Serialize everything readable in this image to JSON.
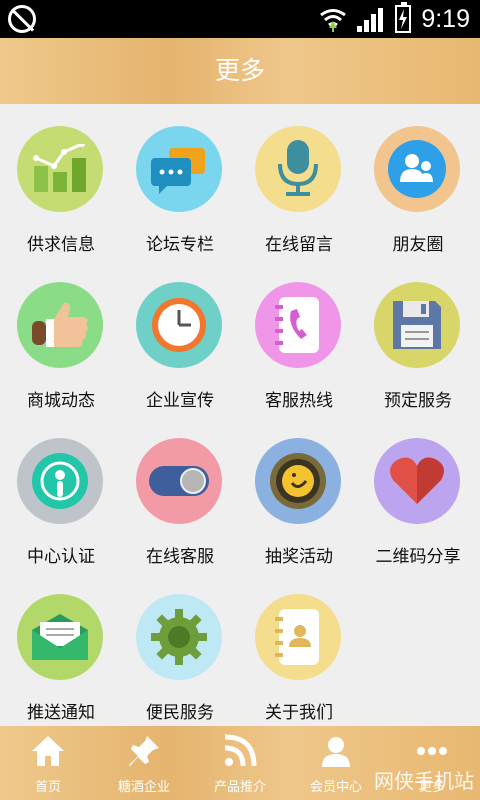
{
  "status": {
    "time": "9:19"
  },
  "header": {
    "title": "更多"
  },
  "grid": [
    {
      "label": "供求信息",
      "icon": "bar-chart-icon",
      "color": "#c5dc72"
    },
    {
      "label": "论坛专栏",
      "icon": "chat-bubbles-icon",
      "color": "#7ad5ef"
    },
    {
      "label": "在线留言",
      "icon": "microphone-icon",
      "color": "#f4dd8c"
    },
    {
      "label": "朋友圈",
      "icon": "friends-icon",
      "color": "#f2c48e"
    },
    {
      "label": "商城动态",
      "icon": "thumb-up-icon",
      "color": "#8bdc86"
    },
    {
      "label": "企业宣传",
      "icon": "clock-icon",
      "color": "#6ed0c6"
    },
    {
      "label": "客服热线",
      "icon": "phone-book-icon",
      "color": "#ef96e9"
    },
    {
      "label": "预定服务",
      "icon": "floppy-disk-icon",
      "color": "#d8d569"
    },
    {
      "label": "中心认证",
      "icon": "certificate-icon",
      "color": "#bfc4ca"
    },
    {
      "label": "在线客服",
      "icon": "toggle-icon",
      "color": "#f29aa6"
    },
    {
      "label": "抽奖活动",
      "icon": "lottery-icon",
      "color": "#8bb1e0"
    },
    {
      "label": "二维码分享",
      "icon": "heart-icon",
      "color": "#bda4ee"
    },
    {
      "label": "推送通知",
      "icon": "envelope-icon",
      "color": "#b2d86a"
    },
    {
      "label": "便民服务",
      "icon": "gear-icon",
      "color": "#bfe8f5"
    },
    {
      "label": "关于我们",
      "icon": "contact-book-icon",
      "color": "#f4dd8c"
    }
  ],
  "tabbar": [
    {
      "label": "首页",
      "icon": "home-icon"
    },
    {
      "label": "糖酒企业",
      "icon": "pin-icon"
    },
    {
      "label": "产品推介",
      "icon": "rss-icon"
    },
    {
      "label": "会员中心",
      "icon": "member-icon"
    },
    {
      "label": "更多",
      "icon": "more-icon"
    }
  ],
  "watermark": "网侠手机站"
}
